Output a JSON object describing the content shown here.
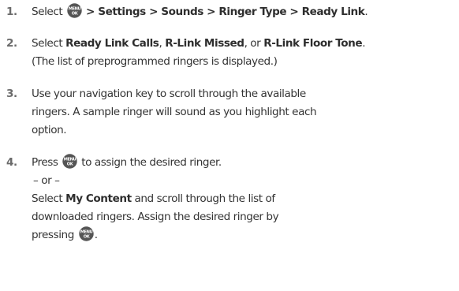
{
  "icon": "menu-ok-key-icon",
  "icon_label_top": "MENU",
  "icon_label_bottom": "OK",
  "steps": [
    {
      "number": "1.",
      "prefix": "Select",
      "path": "> Settings > Sounds > Ringer Type > Ready Link",
      "end": "."
    },
    {
      "number": "2.",
      "prefix": "Select",
      "opt1": "Ready Link Calls",
      "sep1": ",",
      "opt2": "R-Link Missed",
      "sep2": ", or",
      "opt3": "R-Link Floor Tone",
      "end": ".",
      "note": "(The list of preprogrammed ringers is displayed.)"
    },
    {
      "number": "3.",
      "line1": "Use your navigation key to scroll through the available",
      "line2": "ringers. A sample ringer will sound as you highlight each",
      "line3": "option."
    },
    {
      "number": "4.",
      "press": "Press",
      "press_suffix": "to assign the desired ringer.",
      "or": "– or –",
      "select": "Select",
      "my_content": "My Content",
      "line_a_rest": "and scroll through the list of",
      "line_b": "downloaded ringers. Assign the desired ringer by",
      "line_c": "pressing",
      "end": "."
    }
  ]
}
